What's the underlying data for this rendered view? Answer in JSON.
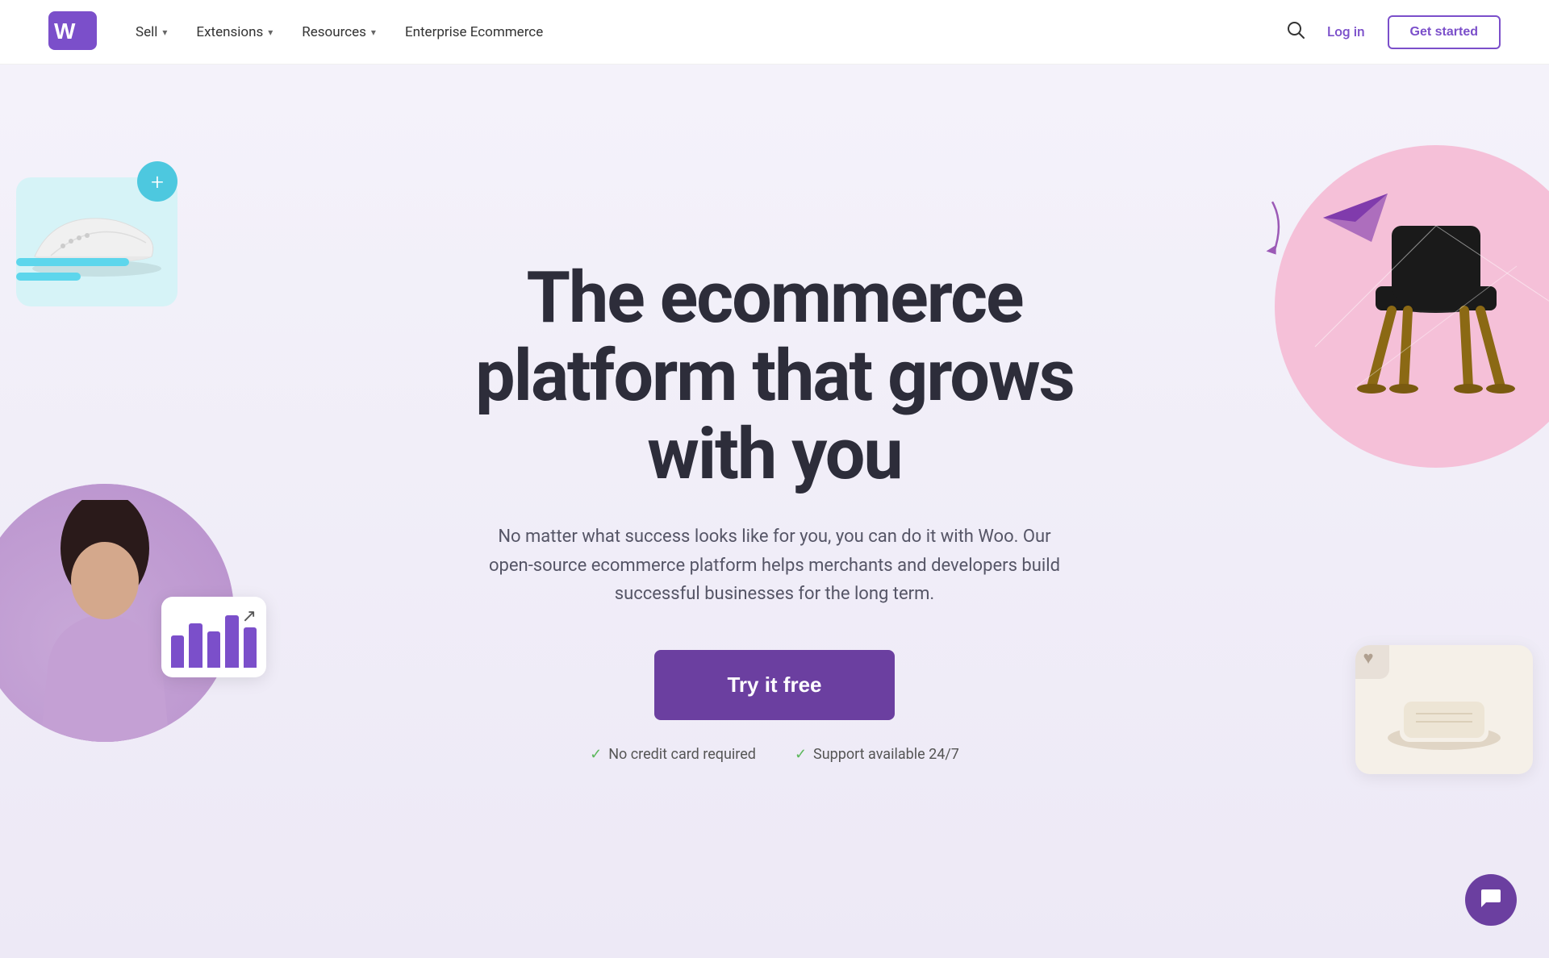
{
  "brand": {
    "name": "Woo",
    "logo_alt": "WooCommerce logo"
  },
  "navbar": {
    "links": [
      {
        "label": "Sell",
        "has_dropdown": true
      },
      {
        "label": "Extensions",
        "has_dropdown": true
      },
      {
        "label": "Resources",
        "has_dropdown": true
      },
      {
        "label": "Enterprise Ecommerce",
        "has_dropdown": false
      }
    ],
    "login_label": "Log in",
    "get_started_label": "Get started",
    "search_aria": "Search"
  },
  "hero": {
    "title_line1": "The ecommerce",
    "title_line2": "platform that grows",
    "title_line3": "with you",
    "subtitle": "No matter what success looks like for you, you can do it with Woo. Our open-source ecommerce platform helps merchants and developers build successful businesses for the long term.",
    "cta_label": "Try it free",
    "badge1": "No credit card required",
    "badge2": "Support available 24/7"
  },
  "colors": {
    "brand_purple": "#7b4fca",
    "brand_purple_dark": "#6b3fa0",
    "hero_bg_start": "#f4f2fa",
    "hero_bg_end": "#ede9f6",
    "teal": "#4dc8df",
    "pink": "#f5c0d8",
    "lavender": "#c8a8d8"
  },
  "decorations": {
    "left": {
      "shoe_alt": "Sneaker product card",
      "plus_label": "+",
      "woman_alt": "Woman working at computer",
      "chart_alt": "Analytics chart"
    },
    "right": {
      "circle_alt": "Pink decorative circle",
      "chair_alt": "Black modern chair product",
      "product_alt": "Soap product card",
      "heart_label": "♥"
    }
  },
  "chat": {
    "icon_alt": "Chat support button"
  }
}
